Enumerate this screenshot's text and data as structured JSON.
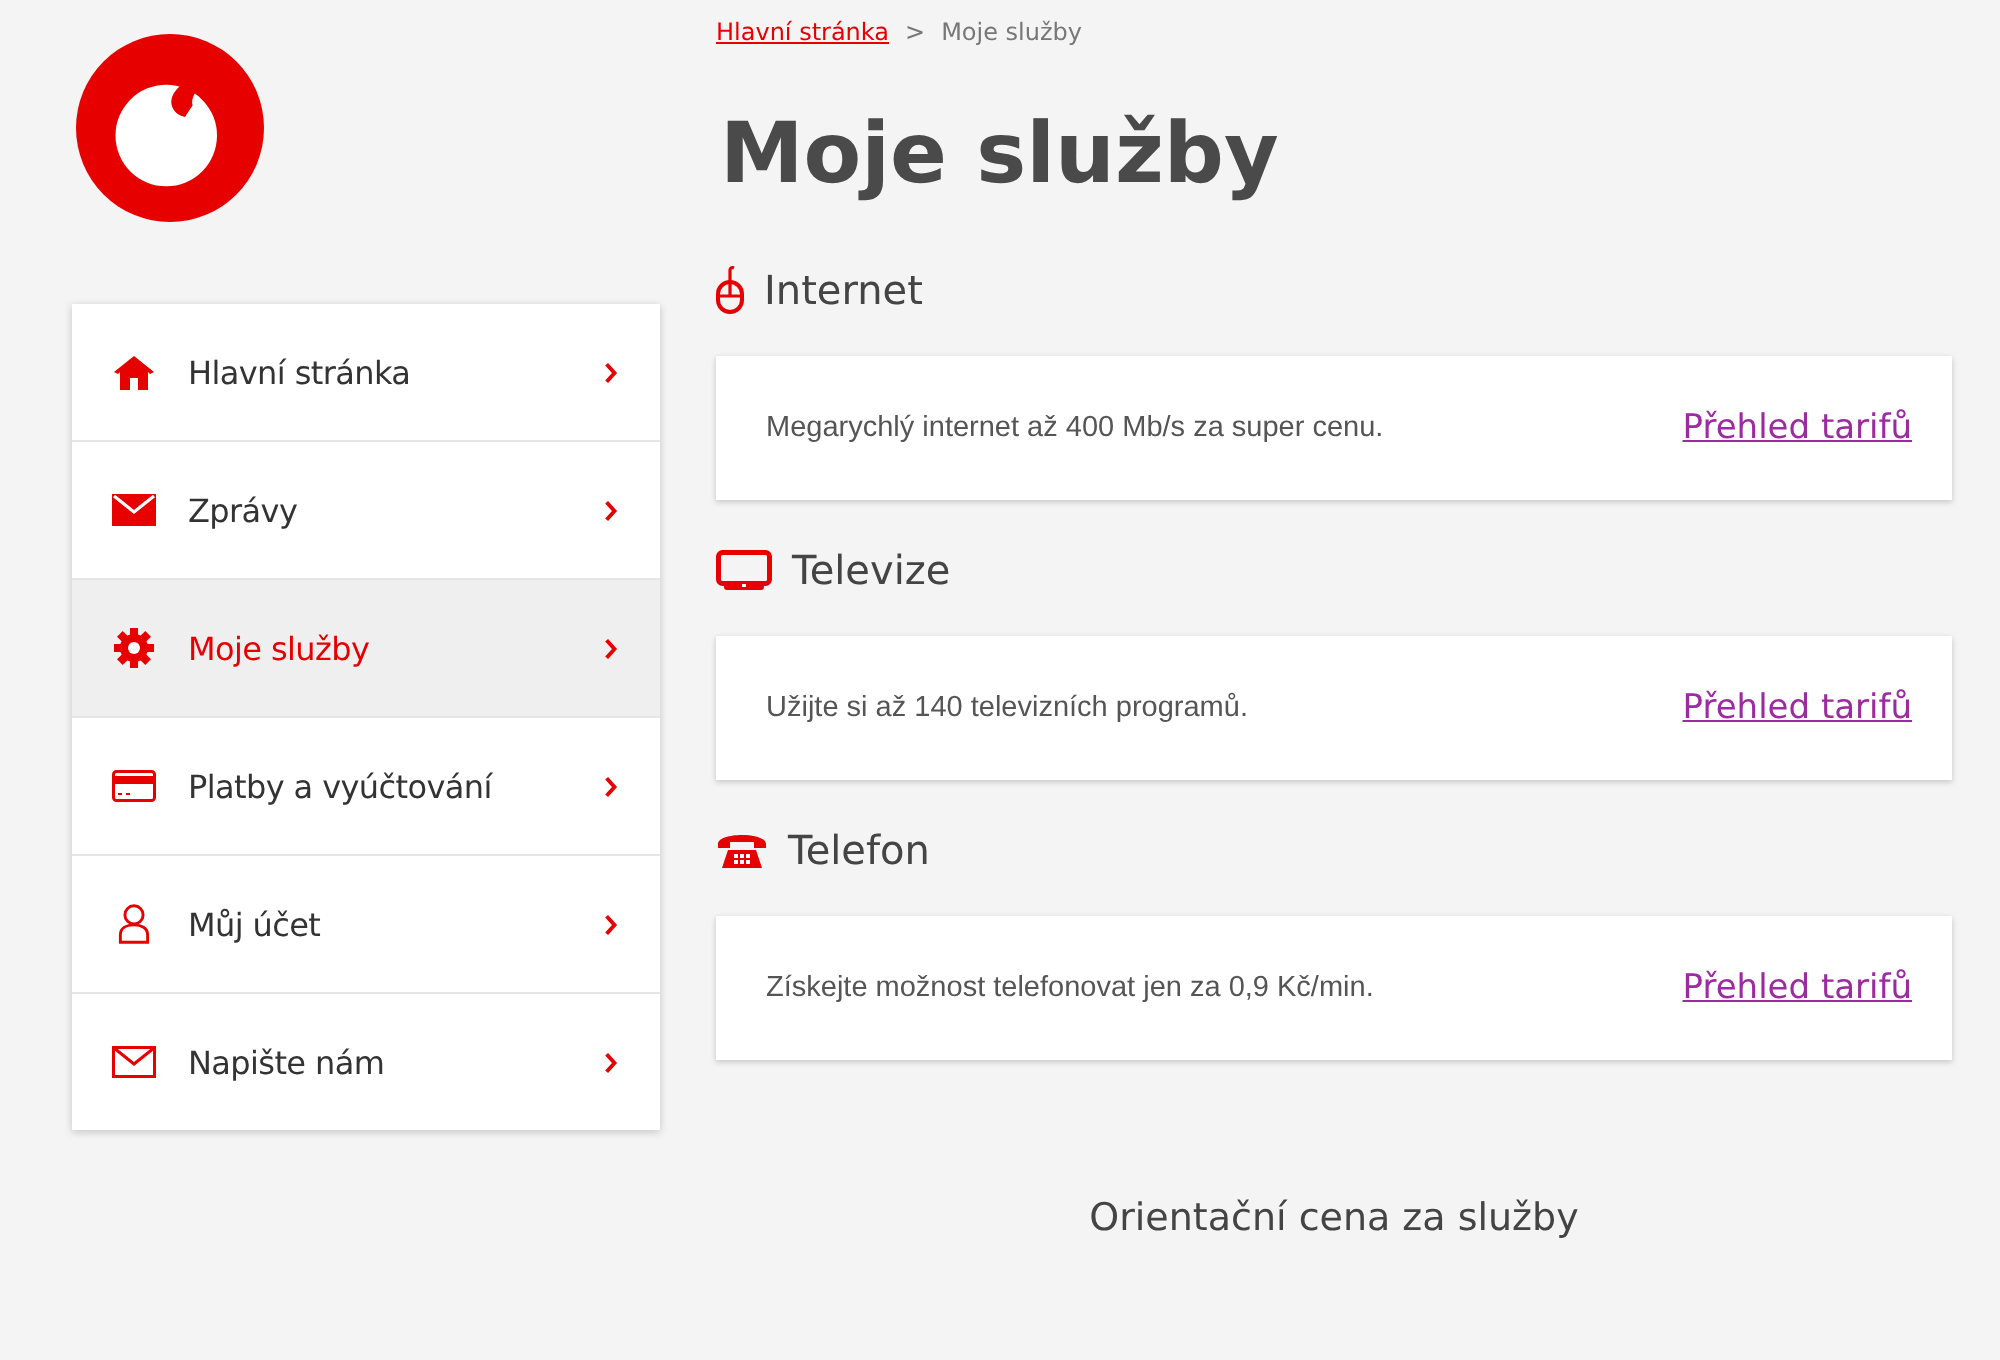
{
  "breadcrumb": [
    {
      "label": "Hlavní stránka",
      "kind": "link"
    },
    {
      "label": "Moje služby",
      "kind": "current"
    }
  ],
  "breadcrumb_separator": ">",
  "title": "Moje služby",
  "sidebar": {
    "items": [
      {
        "label": "Hlavní stránka",
        "kind": "home",
        "selected": false
      },
      {
        "label": "Zprávy",
        "kind": "messages",
        "selected": false
      },
      {
        "label": "Moje služby",
        "kind": "services",
        "selected": true
      },
      {
        "label": "Platby a vyúčtování",
        "kind": "payments",
        "selected": false
      },
      {
        "label": "Můj účet",
        "kind": "account",
        "selected": false
      },
      {
        "label": "Napište nám",
        "kind": "contact",
        "selected": false
      }
    ]
  },
  "services": [
    {
      "heading": "Internet",
      "kind": "internet",
      "text": "Megarychlý internet až 400 Mb/s za super cenu.",
      "link": "Přehled tarifů"
    },
    {
      "heading": "Televize",
      "kind": "tv",
      "text": "Užijte si až 140 televizních programů.",
      "link": "Přehled tarifů"
    },
    {
      "heading": "Telefon",
      "kind": "phone",
      "text": "Získejte možnost telefonovat jen za 0,9 Kč/min.",
      "link": "Přehled tarifů"
    }
  ],
  "footer_heading": "Orientační cena za služby"
}
